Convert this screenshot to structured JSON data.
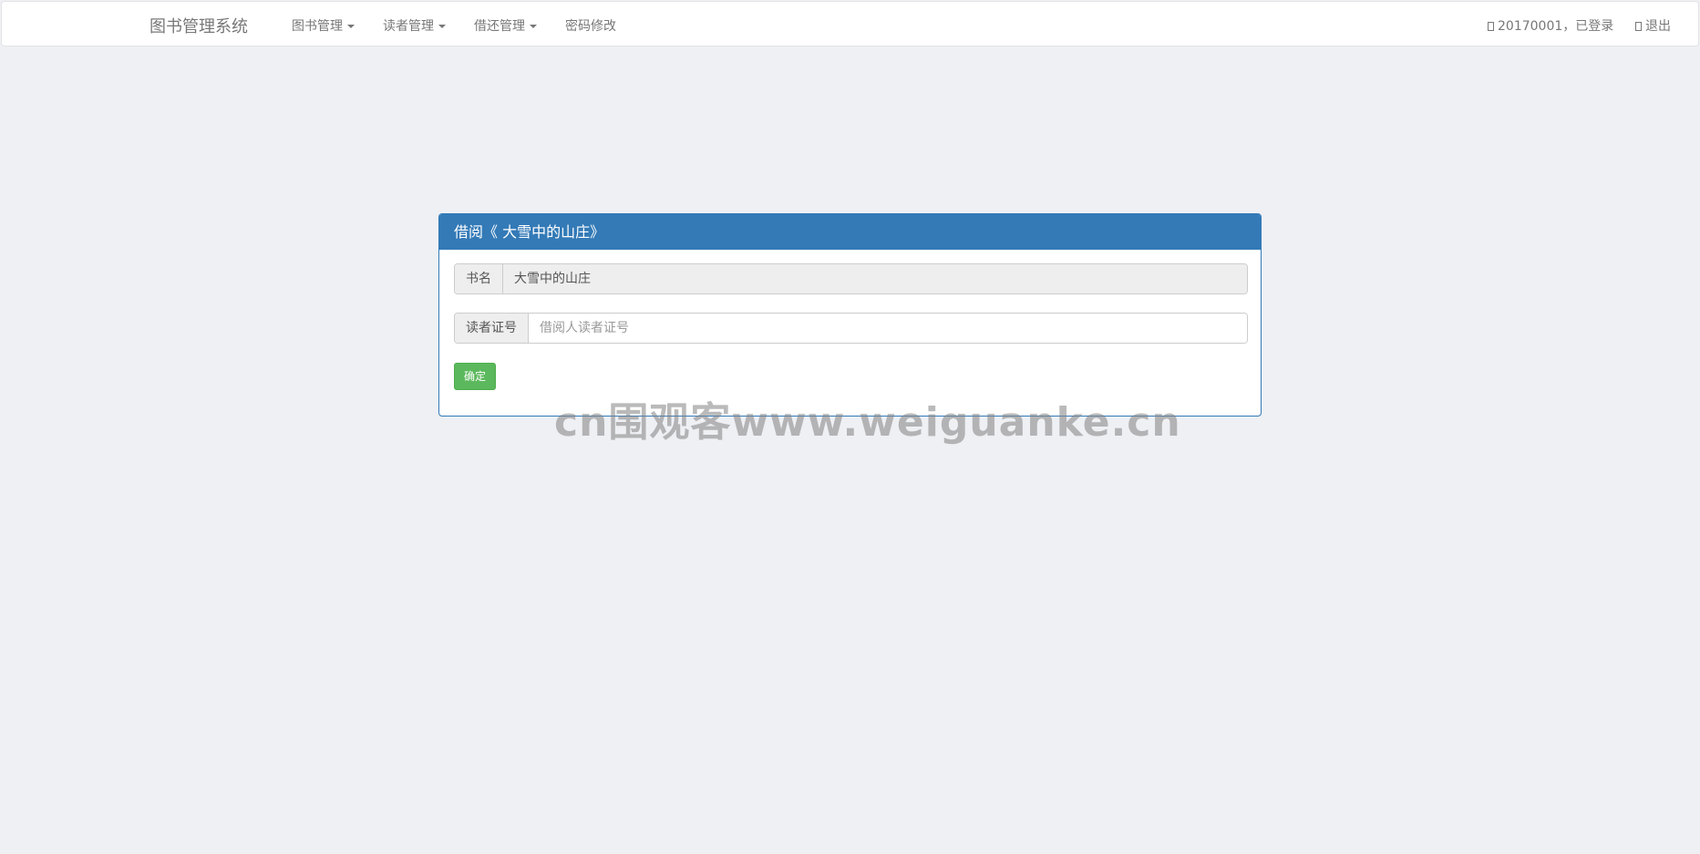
{
  "navbar": {
    "brand": "图书管理系统",
    "menus": [
      {
        "label": "图书管理"
      },
      {
        "label": "读者管理"
      },
      {
        "label": "借还管理"
      },
      {
        "label": "密码修改"
      }
    ],
    "user_status": "20170001，已登录",
    "logout": "退出",
    "user_icon": "user-icon",
    "logout_icon": "logout-icon"
  },
  "panel": {
    "title": "借阅《 大雪中的山庄》",
    "book_label": "书名",
    "book_value": "大雪中的山庄",
    "reader_label": "读者证号",
    "reader_placeholder": "借阅人读者证号",
    "reader_value": "",
    "submit_label": "确定"
  },
  "watermark": "cn围观客www.weiguanke.cn",
  "colors": {
    "background": "#eff0f4",
    "primary": "#337ab7",
    "success": "#5cb85c"
  }
}
